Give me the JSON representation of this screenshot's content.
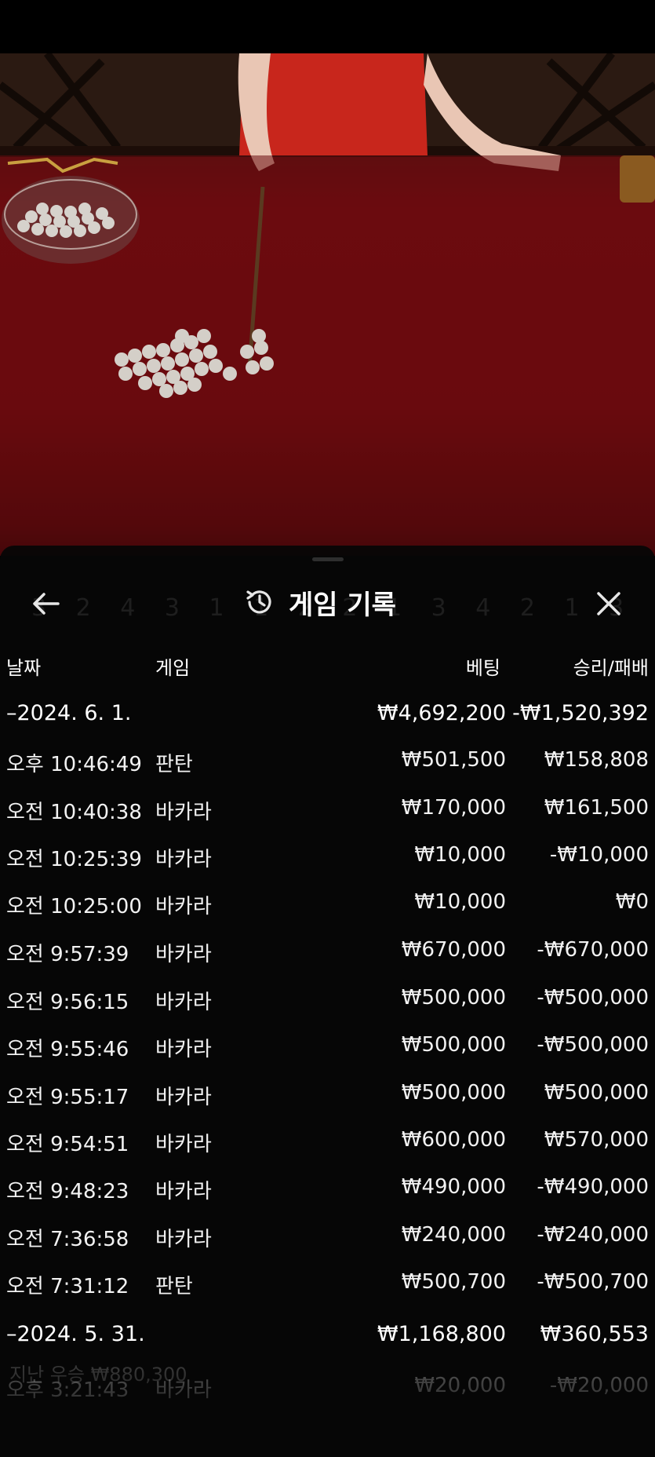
{
  "header": {
    "title": "게임 기록",
    "back_icon": "arrow-left-icon",
    "history_icon": "history-icon",
    "close_icon": "close-icon"
  },
  "background_ghost": {
    "road_digits": "3 2 4 3 1 1 2 2 1 3 4 2 1 3 2",
    "bottom_text": "지난 우승 ₩880,300"
  },
  "columns": {
    "date": "날짜",
    "game": "게임",
    "bet": "베팅",
    "result": "승리/패배"
  },
  "groups": [
    {
      "date": "–2024. 6. 1.",
      "total_bet": "₩4,692,200",
      "total_result": "-₩1,520,392",
      "rows": [
        {
          "time": "오후 10:46:49",
          "game": "판탄",
          "bet": "₩501,500",
          "result": "₩158,808"
        },
        {
          "time": "오전 10:40:38",
          "game": "바카라",
          "bet": "₩170,000",
          "result": "₩161,500"
        },
        {
          "time": "오전 10:25:39",
          "game": "바카라",
          "bet": "₩10,000",
          "result": "-₩10,000"
        },
        {
          "time": "오전 10:25:00",
          "game": "바카라",
          "bet": "₩10,000",
          "result": "₩0"
        },
        {
          "time": "오전 9:57:39",
          "game": "바카라",
          "bet": "₩670,000",
          "result": "-₩670,000"
        },
        {
          "time": "오전 9:56:15",
          "game": "바카라",
          "bet": "₩500,000",
          "result": "-₩500,000"
        },
        {
          "time": "오전 9:55:46",
          "game": "바카라",
          "bet": "₩500,000",
          "result": "-₩500,000"
        },
        {
          "time": "오전 9:55:17",
          "game": "바카라",
          "bet": "₩500,000",
          "result": "₩500,000"
        },
        {
          "time": "오전 9:54:51",
          "game": "바카라",
          "bet": "₩600,000",
          "result": "₩570,000"
        },
        {
          "time": "오전 9:48:23",
          "game": "바카라",
          "bet": "₩490,000",
          "result": "-₩490,000"
        },
        {
          "time": "오전 7:36:58",
          "game": "바카라",
          "bet": "₩240,000",
          "result": "-₩240,000"
        },
        {
          "time": "오전 7:31:12",
          "game": "판탄",
          "bet": "₩500,700",
          "result": "-₩500,700"
        }
      ]
    },
    {
      "date": "–2024. 5. 31.",
      "total_bet": "₩1,168,800",
      "total_result": "₩360,553",
      "rows": [
        {
          "time": "오후 3:21:43",
          "game": "바카라",
          "bet": "₩20,000",
          "result": "-₩20,000"
        }
      ]
    }
  ],
  "colors": {
    "felt": "#6e0c10",
    "panel": "#060606",
    "text": "#ffffff"
  }
}
